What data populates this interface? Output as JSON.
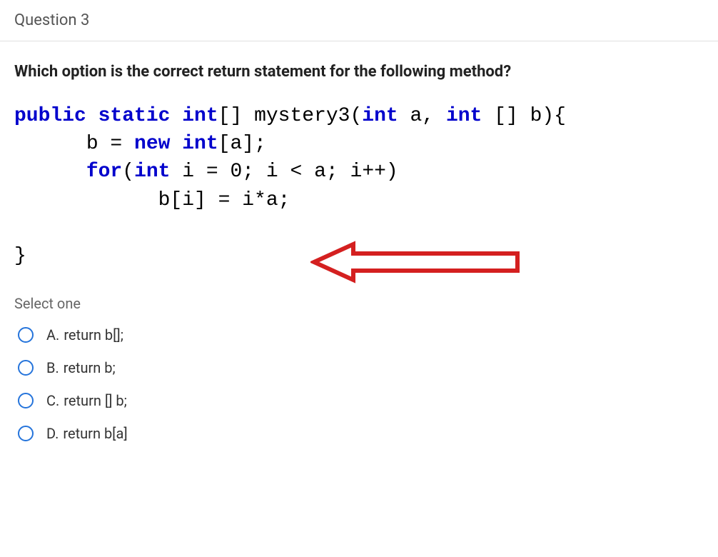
{
  "header": {
    "title": "Question 3"
  },
  "question": {
    "prompt": "Which option is the correct return statement for the following method?"
  },
  "code": {
    "line1_kw": "public static int",
    "line1_rest": "[] mystery3(",
    "line1_kw2": "int",
    "line1_rest2": " a, ",
    "line1_kw3": "int",
    "line1_rest3": " [] b){",
    "line2_pre": "      b = ",
    "line2_kw": "new int",
    "line2_rest": "[a];",
    "line3_pre": "      ",
    "line3_kw": "for",
    "line3_rest": "(",
    "line3_kw2": "int",
    "line3_rest2": " i = 0; i < a; i++)",
    "line4": "            b[i] = i*a;",
    "line5": "",
    "line6": "}"
  },
  "select": {
    "label": "Select one"
  },
  "options": [
    {
      "letter": "A.",
      "text": "return b[];"
    },
    {
      "letter": "B.",
      "text": "return b;"
    },
    {
      "letter": "C.",
      "text": "return [] b;"
    },
    {
      "letter": "D.",
      "text": "return b[a]"
    }
  ]
}
